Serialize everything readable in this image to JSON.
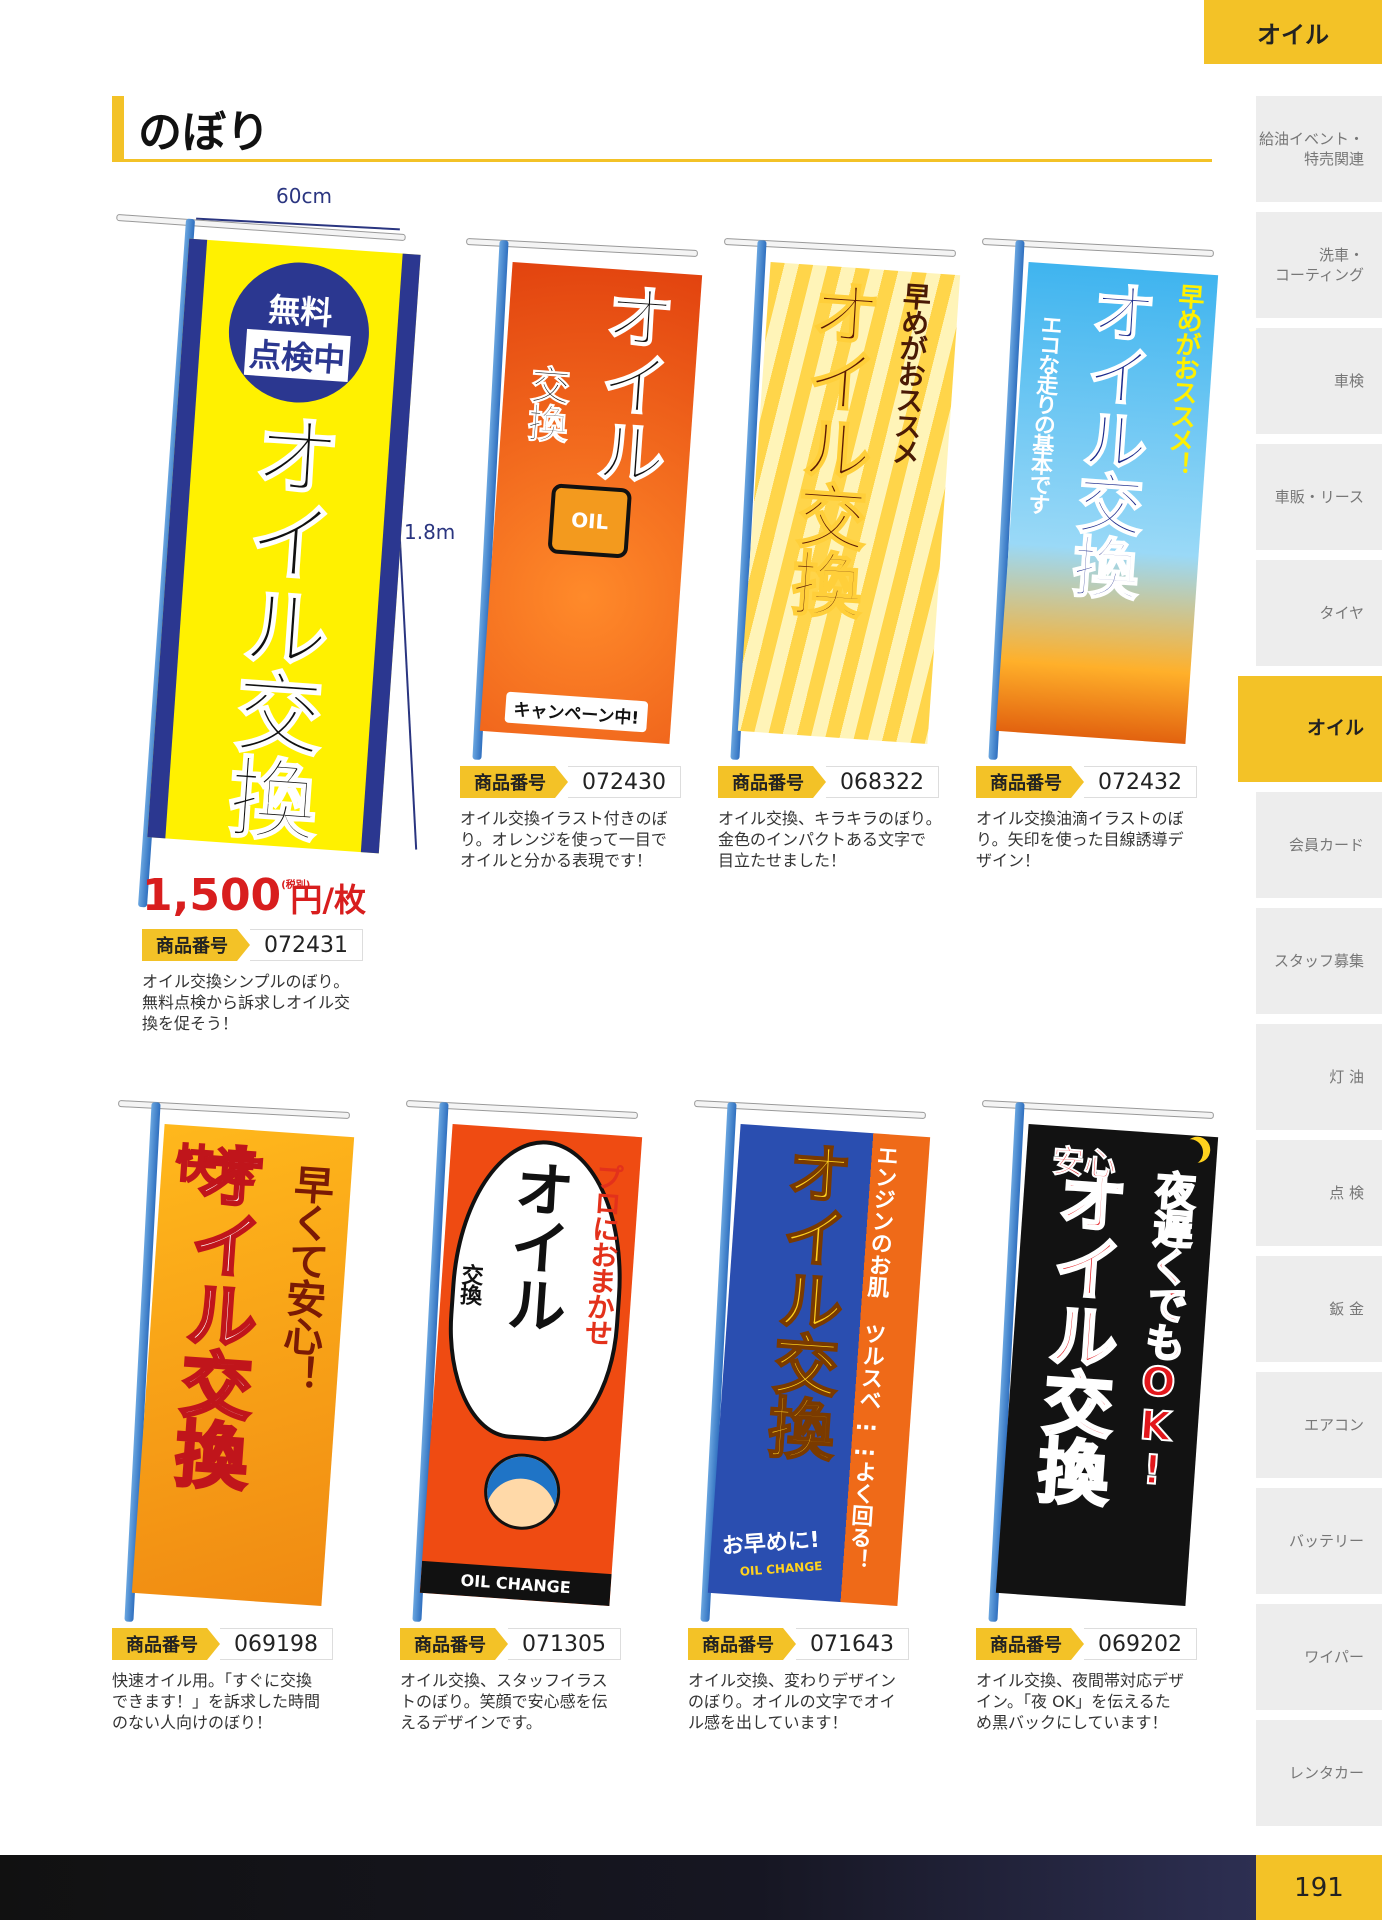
{
  "sidebar": {
    "header": "オイル",
    "tabs": [
      {
        "label": "給油イベント・\n特売関連",
        "active": false
      },
      {
        "label": "洗車・\nコーティング",
        "active": false
      },
      {
        "label": "車検",
        "active": false
      },
      {
        "label": "車販・リース",
        "active": false
      },
      {
        "label": "タイヤ",
        "active": false
      },
      {
        "label": "オイル",
        "active": true
      },
      {
        "label": "会員カード",
        "active": false
      },
      {
        "label": "スタッフ募集",
        "active": false
      },
      {
        "label": "灯 油",
        "active": false
      },
      {
        "label": "点 検",
        "active": false
      },
      {
        "label": "鈑 金",
        "active": false
      },
      {
        "label": "エアコン",
        "active": false
      },
      {
        "label": "バッテリー",
        "active": false
      },
      {
        "label": "ワイパー",
        "active": false
      },
      {
        "label": "レンタカー",
        "active": false
      }
    ]
  },
  "page": {
    "title": "のぼり",
    "number": "191"
  },
  "dimensions": {
    "width": "60cm",
    "height": "1.8m"
  },
  "featured": {
    "banner": {
      "circle_line1": "無料",
      "circle_line2": "点検中",
      "main": "オイル交換"
    },
    "price": "1,500",
    "price_unit": "円/枚",
    "tax_note": "(税別)",
    "code_label": "商品番号",
    "code": "072431",
    "desc": "オイル交換シンプルのぼり。\n無料点検から訴求しオイル交\n換を促そう！"
  },
  "products": [
    {
      "code_label": "商品番号",
      "code": "072430",
      "desc": "オイル交換イラスト付きのぼ\nり。オレンジを使って一目で\nオイルと分かる表現です！",
      "banner": {
        "main": "オイル",
        "sub": "交換",
        "bottom": "キャンペーン中!",
        "can_label": "OIL"
      }
    },
    {
      "code_label": "商品番号",
      "code": "068322",
      "desc": "オイル交換、キラキラのぼり。\n金色のインパクトある文字で\n目立たせました！",
      "banner": {
        "sub": "早めがおススメ",
        "main": "オイル交換"
      }
    },
    {
      "code_label": "商品番号",
      "code": "072432",
      "desc": "オイル交換油滴イラストのぼ\nり。矢印を使った目線誘導デ\nザイン！",
      "banner": {
        "sub1": "早めがおススメ！",
        "sub2": "エコな走りの基本です",
        "main": "オイル交換"
      }
    },
    {
      "code_label": "商品番号",
      "code": "069198",
      "desc": "快速オイル用。「すぐに交換\nできます！」を訴求した時間\nのない人向けのぼり！",
      "banner": {
        "top": "快速",
        "sub": "早くて安心！",
        "main": "オイル交換"
      }
    },
    {
      "code_label": "商品番号",
      "code": "071305",
      "desc": "オイル交換、スタッフイラス\nトのぼり。笑顔で安心感を伝\nえるデザインです。",
      "banner": {
        "sub": "プロにおまかせ",
        "main": "オイル",
        "main2": "交換",
        "bottom": "OIL CHANGE"
      }
    },
    {
      "code_label": "商品番号",
      "code": "071643",
      "desc": "オイル交換、変わりデザイン\nのぼり。オイルの文字でオイ\nル感を出しています！",
      "banner": {
        "sub": "エンジンのお肌 ツルスベ……よく回る！",
        "main": "オイル交換",
        "bottom": "お早めに!",
        "bottom2": "OIL CHANGE"
      }
    },
    {
      "code_label": "商品番号",
      "code": "069202",
      "desc": "オイル交換、夜間帯対応デザ\nイン。「夜 OK」を伝えるた\nめ黒バックにしています！",
      "banner": {
        "top": "安心",
        "sub": "夜遅くでもOK!",
        "main": "オイル交換"
      }
    }
  ],
  "colors": {
    "accent": "#f3c227",
    "price": "#d81e1e",
    "navy": "#2a3580"
  }
}
